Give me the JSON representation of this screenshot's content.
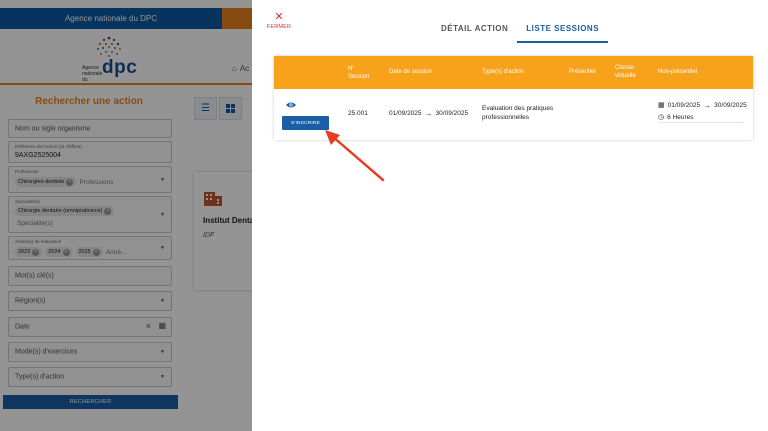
{
  "background": {
    "banner_text": "Agence nationale du DPC",
    "logo": {
      "small_text": "Agence nationale du",
      "brand": "dpc"
    },
    "home_link": "Ac",
    "search_title": "Rechercher une action",
    "fields": {
      "name_placeholder": "Nom ou sigle organisme",
      "reference_label": "Référence de l'action (11 chiffres)",
      "reference_value": "9AXG2525004",
      "professions_label": "Professions",
      "professions_chip": "Chirurgien-dentiste",
      "professions_placeholder": "Professions",
      "specialites_label": "Spécialité(s)",
      "specialites_chip": "Chirurgie dentaire (omnipraticiens)",
      "specialites_placeholder": "Spécialité(s)",
      "annees_label": "Année(s) de réalisation",
      "annees_chips": [
        "2023",
        "2024",
        "2025"
      ],
      "annees_placeholder": "Anné...",
      "motscles_placeholder": "Mot(s) clé(s)",
      "region_placeholder": "Région(s)",
      "date_placeholder": "Date",
      "modes_placeholder": "Mode(s) d'exercices",
      "type_placeholder": "Type(s) d'action"
    },
    "search_button": "RECHERCHER",
    "result": {
      "title": "Institut Dentaire",
      "region": "IDF"
    }
  },
  "panel": {
    "close_label": "FERMER",
    "tabs": [
      {
        "label": "DÉTAIL ACTION",
        "active": false
      },
      {
        "label": "LISTE SESSIONS",
        "active": true
      }
    ],
    "table": {
      "headers": {
        "session": [
          "N°",
          "Session"
        ],
        "date": "Date de session",
        "types": "Type(s) d'action",
        "presentiel": "Présentiel",
        "classe": [
          "Classe-",
          "virtuelle"
        ],
        "non_presentiel": "Non-présentiel"
      },
      "rows": [
        {
          "button": "S'INSCRIRE",
          "session": "25.001",
          "date_start": "01/09/2025",
          "date_end": "30/09/2025",
          "type_lines": [
            "Evaluation des pratiques",
            "professionnelles"
          ],
          "np_start": "01/09/2025",
          "np_end": "30/09/2025",
          "np_duration": "6 Heures"
        }
      ]
    }
  },
  "colors": {
    "primary_blue": "#1a5ea8",
    "orange": "#f8a11a",
    "close_red": "#d32f2f",
    "annotation_arrow": "#e53b1f"
  }
}
